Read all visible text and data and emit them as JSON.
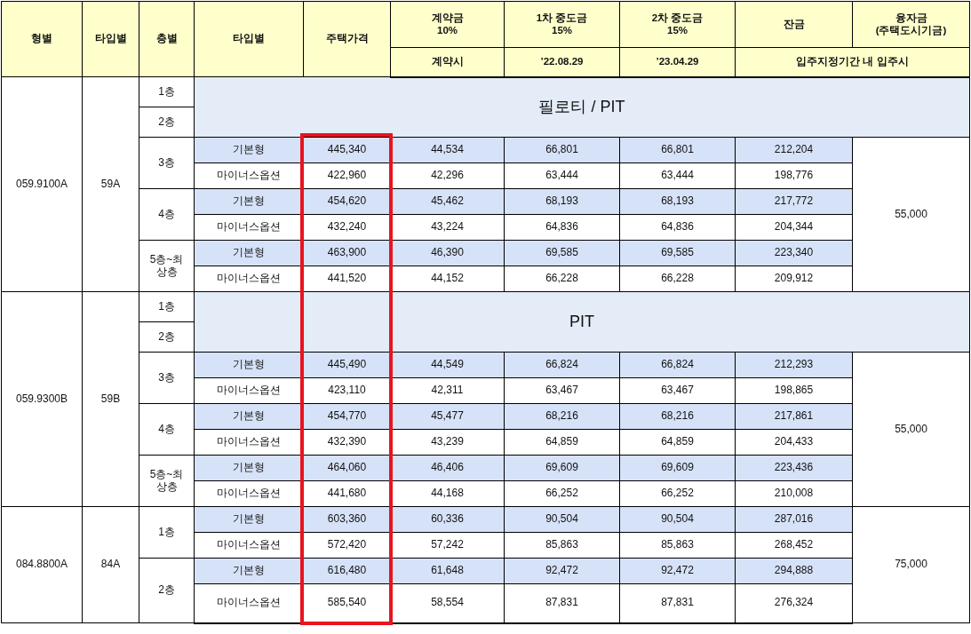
{
  "header": {
    "columns": [
      {
        "label": "형별",
        "highlighted": false
      },
      {
        "label": "타입별",
        "highlighted": false
      },
      {
        "label": "층별",
        "highlighted": false
      },
      {
        "label": "타입별",
        "highlighted": false
      },
      {
        "label": "주택가격",
        "highlighted": true
      },
      {
        "label": "계약금",
        "note": "10%",
        "due": "계약시",
        "highlighted": false
      },
      {
        "label": "1차 중도금",
        "note": "15%",
        "due": "’22.08.29",
        "highlighted": false
      },
      {
        "label": "2차 중도금",
        "note": "15%",
        "due": "’23.04.29",
        "highlighted": false
      },
      {
        "label": "잔금",
        "highlighted": false
      },
      {
        "label": "융자금",
        "note": "(주택도시기금)",
        "highlighted": false
      }
    ],
    "balance_due": "입주지정기간 내 입주시"
  },
  "groups": [
    {
      "model": "059.9100A",
      "type": "59A",
      "loan": "55,000",
      "pit_floors": [
        "1층",
        "2층"
      ],
      "pit_label": "필로티 / PIT",
      "floors": [
        {
          "floor": "3층",
          "rows": [
            {
              "kind": "basic",
              "option": "기본형",
              "price": "445,340",
              "deposit": "44,534",
              "interim_1": "66,801",
              "interim_2": "66,801",
              "balance": "212,204"
            },
            {
              "kind": "minus",
              "option": "마이너스옵션",
              "price": "422,960",
              "deposit": "42,296",
              "interim_1": "63,444",
              "interim_2": "63,444",
              "balance": "198,776"
            }
          ]
        },
        {
          "floor": "4층",
          "rows": [
            {
              "kind": "basic",
              "option": "기본형",
              "price": "454,620",
              "deposit": "45,462",
              "interim_1": "68,193",
              "interim_2": "68,193",
              "balance": "217,772"
            },
            {
              "kind": "minus",
              "option": "마이너스옵션",
              "price": "432,240",
              "deposit": "43,224",
              "interim_1": "64,836",
              "interim_2": "64,836",
              "balance": "204,344"
            }
          ]
        },
        {
          "floor": "5층~최상층",
          "rows": [
            {
              "kind": "basic",
              "option": "기본형",
              "price": "463,900",
              "deposit": "46,390",
              "interim_1": "69,585",
              "interim_2": "69,585",
              "balance": "223,340"
            },
            {
              "kind": "minus",
              "option": "마이너스옵션",
              "price": "441,520",
              "deposit": "44,152",
              "interim_1": "66,228",
              "interim_2": "66,228",
              "balance": "209,912"
            }
          ]
        }
      ]
    },
    {
      "model": "059.9300B",
      "type": "59B",
      "loan": "55,000",
      "pit_floors": [
        "1층",
        "2층"
      ],
      "pit_label": "PIT",
      "floors": [
        {
          "floor": "3층",
          "rows": [
            {
              "kind": "basic",
              "option": "기본형",
              "price": "445,490",
              "deposit": "44,549",
              "interim_1": "66,824",
              "interim_2": "66,824",
              "balance": "212,293"
            },
            {
              "kind": "minus",
              "option": "마이너스옵션",
              "price": "423,110",
              "deposit": "42,311",
              "interim_1": "63,467",
              "interim_2": "63,467",
              "balance": "198,865"
            }
          ]
        },
        {
          "floor": "4층",
          "rows": [
            {
              "kind": "basic",
              "option": "기본형",
              "price": "454,770",
              "deposit": "45,477",
              "interim_1": "68,216",
              "interim_2": "68,216",
              "balance": "217,861"
            },
            {
              "kind": "minus",
              "option": "마이너스옵션",
              "price": "432,390",
              "deposit": "43,239",
              "interim_1": "64,859",
              "interim_2": "64,859",
              "balance": "204,433"
            }
          ]
        },
        {
          "floor": "5층~최상층",
          "rows": [
            {
              "kind": "basic",
              "option": "기본형",
              "price": "464,060",
              "deposit": "46,406",
              "interim_1": "69,609",
              "interim_2": "69,609",
              "balance": "223,436"
            },
            {
              "kind": "minus",
              "option": "마이너스옵션",
              "price": "441,680",
              "deposit": "44,168",
              "interim_1": "66,252",
              "interim_2": "66,252",
              "balance": "210,008"
            }
          ]
        }
      ]
    },
    {
      "model": "084.8800A",
      "type": "84A",
      "loan": "75,000",
      "floors": [
        {
          "floor": "1층",
          "rows": [
            {
              "kind": "basic",
              "option": "기본형",
              "price": "603,360",
              "deposit": "60,336",
              "interim_1": "90,504",
              "interim_2": "90,504",
              "balance": "287,016"
            },
            {
              "kind": "minus",
              "option": "마이너스옵션",
              "price": "572,420",
              "deposit": "57,242",
              "interim_1": "85,863",
              "interim_2": "85,863",
              "balance": "268,452"
            }
          ]
        },
        {
          "floor": "2층",
          "rows": [
            {
              "kind": "basic",
              "option": "기본형",
              "price": "616,480",
              "deposit": "61,648",
              "interim_1": "92,472",
              "interim_2": "92,472",
              "balance": "294,888"
            },
            {
              "kind": "minus",
              "option": "마이너스옵션",
              "price": "585,540",
              "deposit": "58,554",
              "interim_1": "87,831",
              "interim_2": "87,831",
              "balance": "276,324"
            }
          ]
        }
      ]
    }
  ]
}
